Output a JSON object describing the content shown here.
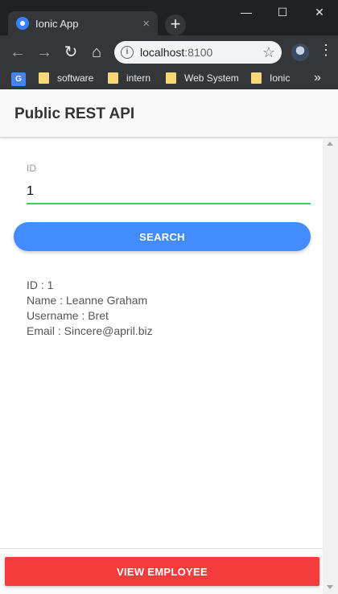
{
  "browser": {
    "tab_title": "Ionic App",
    "tab_close": "×",
    "new_tab": "+",
    "window_controls": {
      "minimize": "—",
      "maximize": "☐",
      "close": "✕"
    },
    "url_host": "localhost",
    "url_port": ":8100",
    "bookmarks": [
      "software",
      "intern",
      "Web System",
      "Ionic"
    ],
    "bookmarks_more": "»"
  },
  "app": {
    "title": "Public REST API",
    "id_field": {
      "label": "ID",
      "value": "1"
    },
    "search_button": "SEARCH",
    "result": {
      "id_line": "ID : 1",
      "name_line": "Name : Leanne Graham",
      "username_line": "Username : Bret",
      "email_line": "Email : Sincere@april.biz"
    },
    "view_employee_button": "VIEW EMPLOYEE"
  },
  "colors": {
    "primary": "#428cff",
    "success": "#2dd36f",
    "danger": "#f43c3c"
  }
}
